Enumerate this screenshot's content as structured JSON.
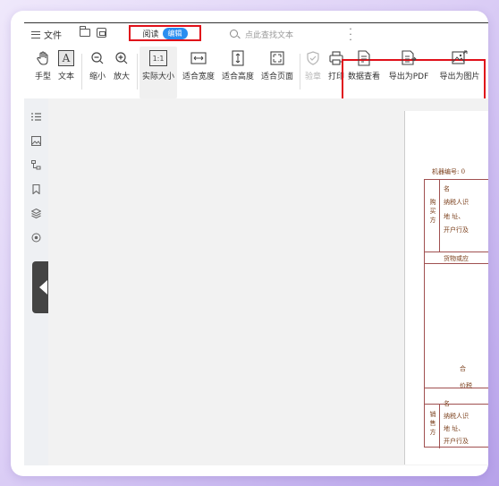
{
  "menubar": {
    "file_label": "文件",
    "mode_read": "阅读",
    "mode_edit": "编辑",
    "search_placeholder": "点此查找文本"
  },
  "toolbar": {
    "hand": "手型",
    "text": "文本",
    "zoom_out": "缩小",
    "zoom_in": "放大",
    "actual_size": "实际大小",
    "actual_size_icon": "1:1",
    "fit_width": "适合宽度",
    "fit_height": "适合高度",
    "fit_page": "适合页面",
    "verify": "验章",
    "print": "打印",
    "data_view": "数据查看",
    "export_pdf": "导出为PDF",
    "export_image": "导出为图片"
  },
  "document": {
    "machine_no": "机器编号: 0",
    "buyer_label": "购买方",
    "name_label": "名",
    "taxpayer_label": "纳税人识",
    "address_label": "地 址、",
    "bank_label": "开户行及",
    "goods_label": "货物或应",
    "total_label": "合",
    "tax_total_label": "价税",
    "seller_label": "销售方",
    "seller_name_label": "名",
    "seller_taxpayer_label": "纳税人识",
    "seller_address_label": "地 址、",
    "seller_bank_label": "开户行及"
  },
  "colors": {
    "highlight": "#e0101a",
    "edit_badge": "#2b8ef0",
    "invoice_brown": "#7a3e1a"
  }
}
